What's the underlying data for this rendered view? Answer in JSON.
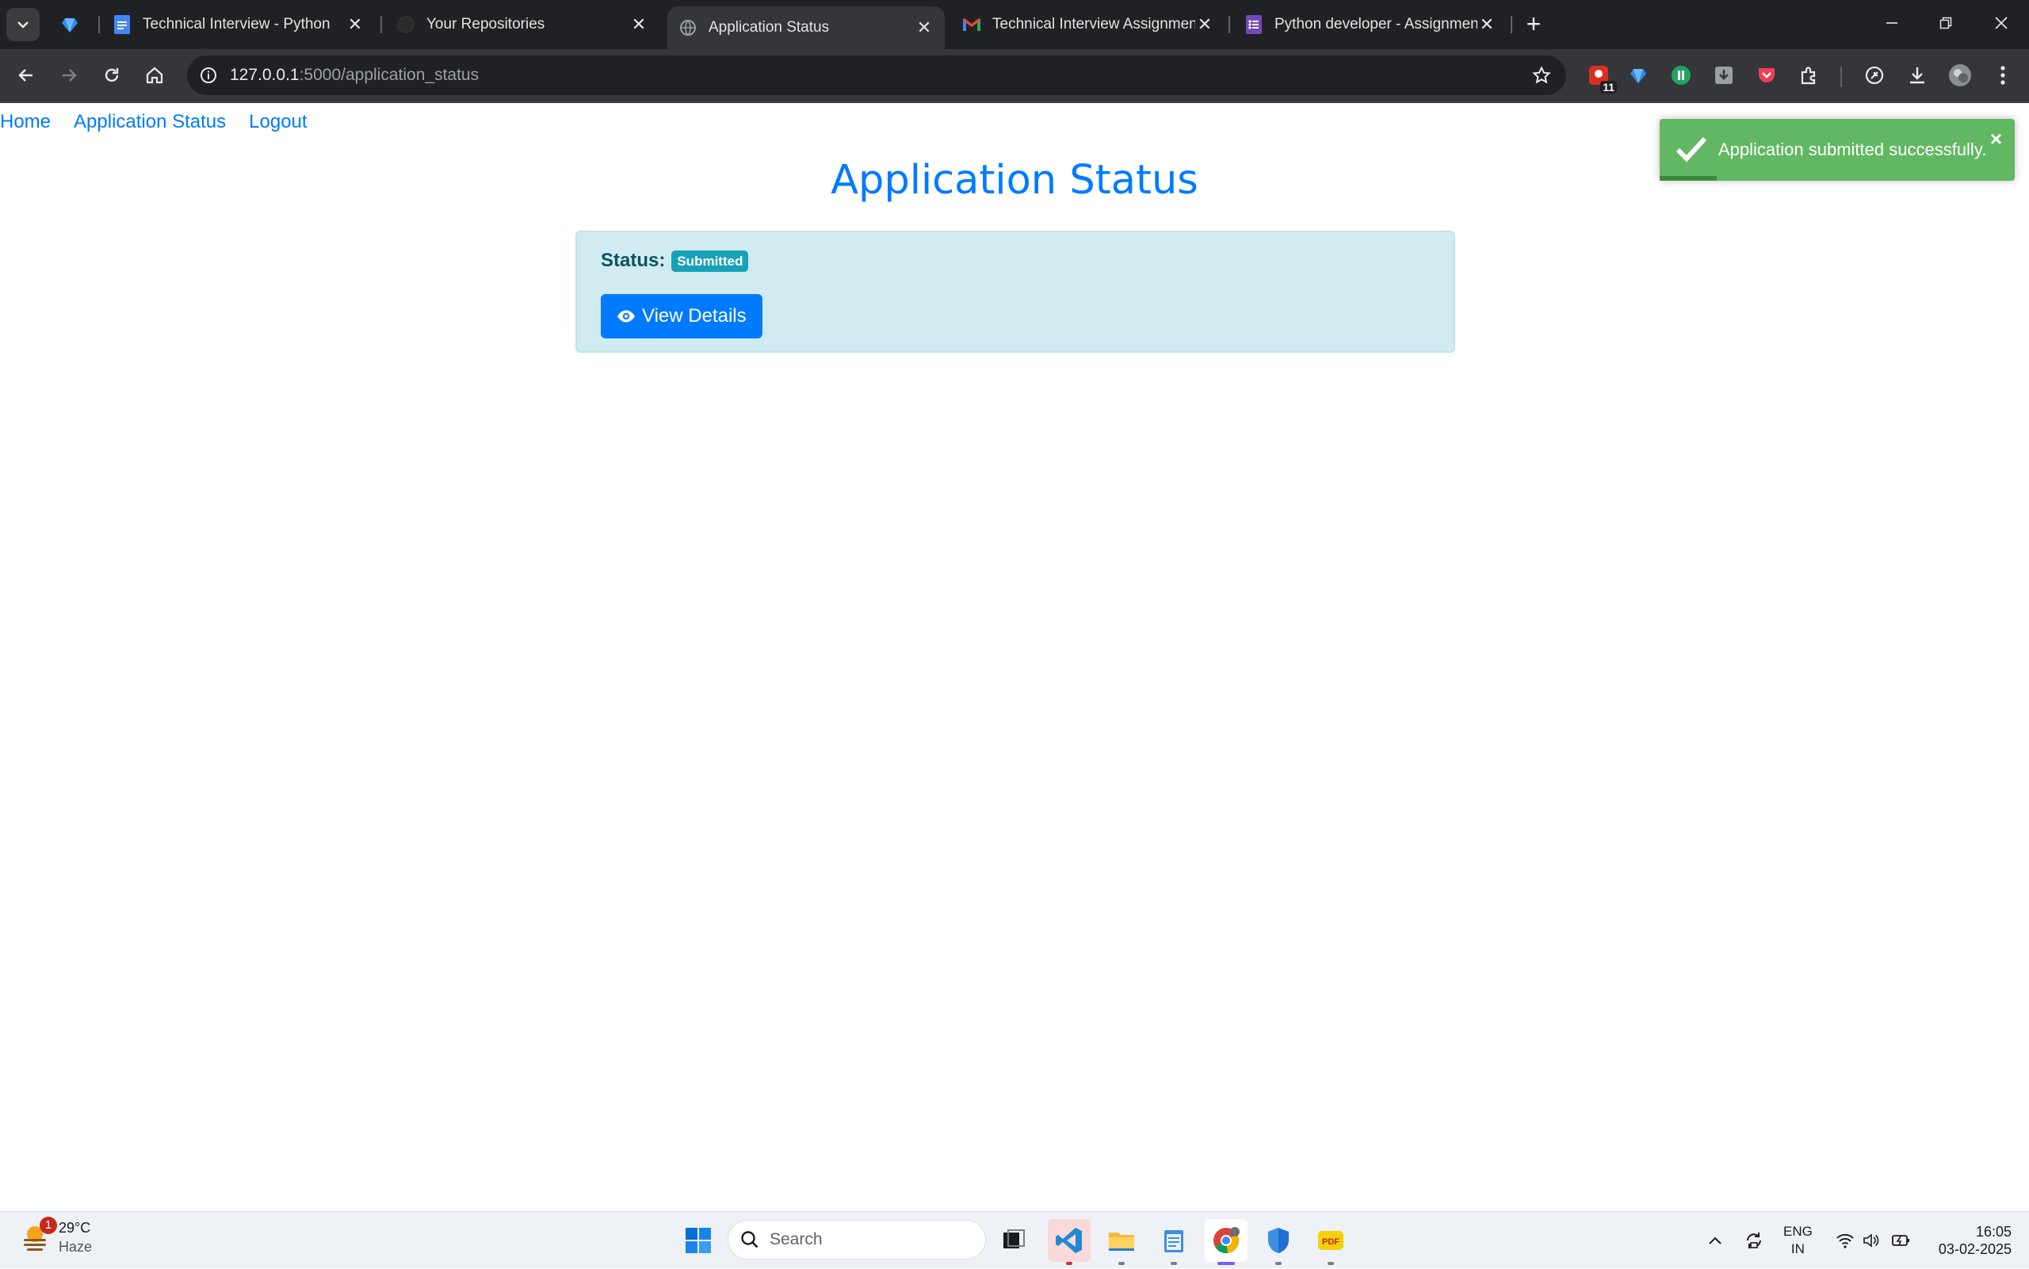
{
  "browser": {
    "tabs": [
      {
        "title": "Technical Interview - Python",
        "active": false
      },
      {
        "title": "Your Repositories",
        "active": false
      },
      {
        "title": "Application Status",
        "active": true
      },
      {
        "title": "Technical Interview Assignment",
        "active": false
      },
      {
        "title": "Python developer - Assignment",
        "active": false
      }
    ],
    "url_host": "127.0.0.1",
    "url_path": ":5000/application_status",
    "extension_badge": "11"
  },
  "page": {
    "nav": {
      "home": "Home",
      "status": "Application Status",
      "logout": "Logout"
    },
    "title": "Application Status",
    "status_label": "Status:",
    "status_badge": "Submitted",
    "view_details": "View Details",
    "toast": {
      "message": "Application submitted successfully.",
      "close": "×",
      "progress": 0.16
    }
  },
  "taskbar": {
    "weather_temp": "29°C",
    "weather_cond": "Haze",
    "weather_badge": "1",
    "search_placeholder": "Search",
    "lang_top": "ENG",
    "lang_bottom": "IN",
    "time": "16:05",
    "date": "03-02-2025"
  },
  "colors": {
    "link": "#007bff",
    "alert_info_bg": "#d1ecf1",
    "alert_info_text": "#0c5460",
    "badge_info": "#17a2b8",
    "toast_success": "#62b862"
  }
}
